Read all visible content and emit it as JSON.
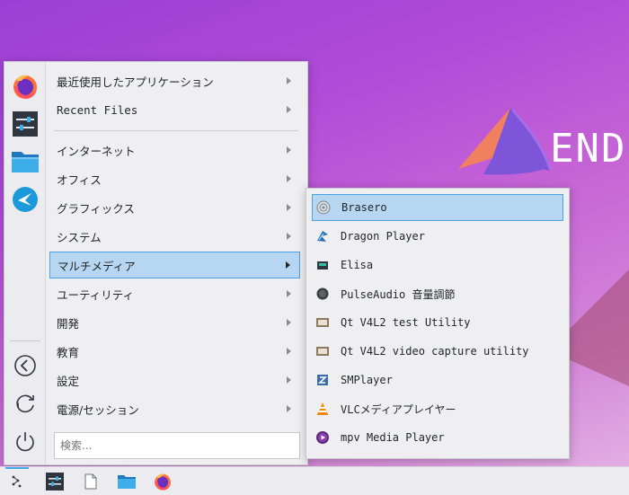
{
  "desktop": {
    "logo_text": "ENDE"
  },
  "favorites": [
    {
      "name": "firefox-icon"
    },
    {
      "name": "settings-icon"
    },
    {
      "name": "file-manager-icon"
    },
    {
      "name": "app-icon"
    }
  ],
  "session": [
    {
      "name": "back-icon"
    },
    {
      "name": "refresh-icon"
    },
    {
      "name": "power-icon"
    }
  ],
  "categories": [
    {
      "label": "最近使用したアプリケーション"
    },
    {
      "label": "Recent Files"
    },
    {
      "label": "インターネット"
    },
    {
      "label": "オフィス"
    },
    {
      "label": "グラフィックス"
    },
    {
      "label": "システム"
    },
    {
      "label": "マルチメディア"
    },
    {
      "label": "ユーティリティ"
    },
    {
      "label": "開発"
    },
    {
      "label": "教育"
    },
    {
      "label": "設定"
    },
    {
      "label": "電源/セッション"
    }
  ],
  "search": {
    "placeholder": "検索..."
  },
  "submenu": [
    {
      "label": "Brasero"
    },
    {
      "label": "Dragon Player"
    },
    {
      "label": "Elisa"
    },
    {
      "label": "PulseAudio 音量調節"
    },
    {
      "label": "Qt V4L2 test Utility"
    },
    {
      "label": "Qt V4L2 video capture utility"
    },
    {
      "label": "SMPlayer"
    },
    {
      "label": "VLCメディアプレイヤー"
    },
    {
      "label": "mpv Media Player"
    }
  ],
  "colors": {
    "accent": "#3daee9",
    "highlight": "#b7d6f2"
  }
}
